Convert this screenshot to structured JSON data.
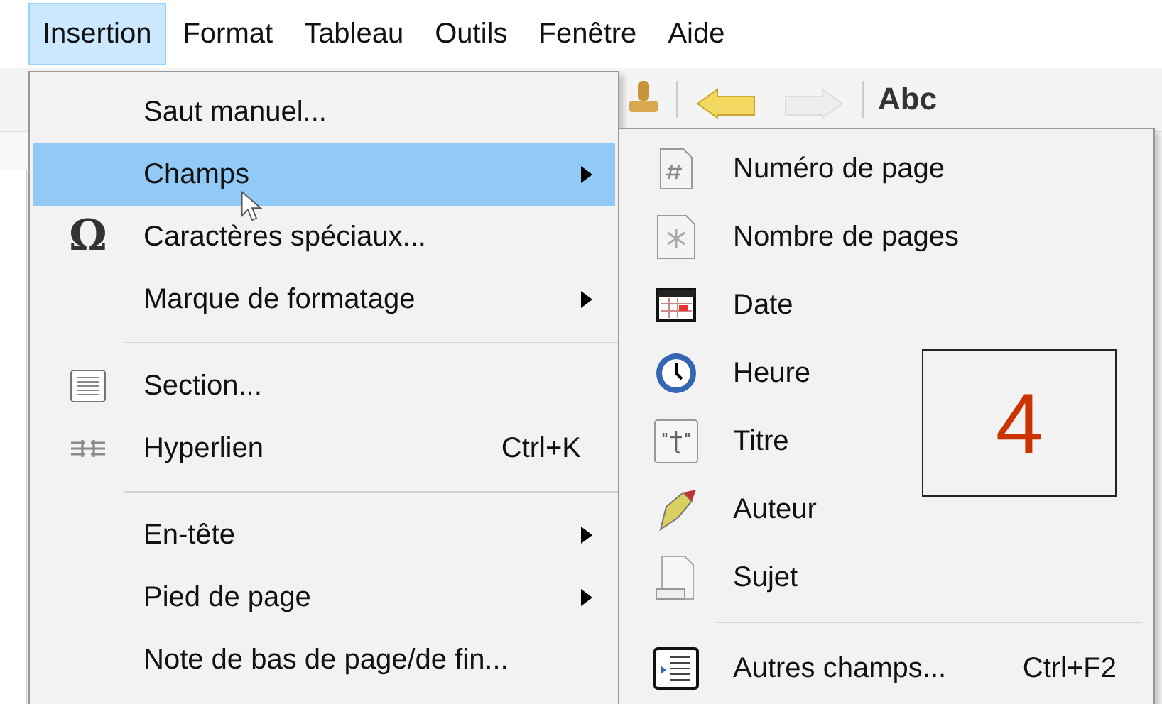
{
  "menu_bar": [
    {
      "label": "Insertion",
      "selected": true
    },
    {
      "label": "Format",
      "selected": false
    },
    {
      "label": "Tableau",
      "selected": false
    },
    {
      "label": "Outils",
      "selected": false
    },
    {
      "label": "Fenêtre",
      "selected": false
    },
    {
      "label": "Aide",
      "selected": false
    }
  ],
  "toolbar": {
    "spelling_label": "Abc"
  },
  "menu": {
    "items": [
      {
        "kind": "item",
        "label": "Saut manuel...",
        "has_submenu": false,
        "selected": false
      },
      {
        "kind": "item",
        "label": "Champs",
        "has_submenu": true,
        "selected": true
      },
      {
        "kind": "item",
        "icon_glyph": "Ω",
        "label": "Caractères spéciaux...",
        "has_submenu": false,
        "selected": false
      },
      {
        "kind": "item",
        "label": "Marque de formatage",
        "has_submenu": true,
        "selected": false
      },
      {
        "kind": "separator"
      },
      {
        "kind": "item",
        "label": "Section...",
        "has_submenu": false,
        "selected": false
      },
      {
        "kind": "item",
        "label": "Hyperlien",
        "shortcut": "Ctrl+K",
        "has_submenu": false,
        "selected": false
      },
      {
        "kind": "separator"
      },
      {
        "kind": "item",
        "label": "En-tête",
        "has_submenu": true,
        "selected": false
      },
      {
        "kind": "item",
        "label": "Pied de page",
        "has_submenu": true,
        "selected": false
      },
      {
        "kind": "item",
        "label": "Note de bas de page/de fin...",
        "has_submenu": false,
        "selected": false
      }
    ]
  },
  "submenu": {
    "items": [
      {
        "kind": "item",
        "label": "Numéro de page"
      },
      {
        "kind": "item",
        "label": "Nombre de pages"
      },
      {
        "kind": "item",
        "label": "Date"
      },
      {
        "kind": "item",
        "label": "Heure"
      },
      {
        "kind": "item",
        "label": "Titre"
      },
      {
        "kind": "item",
        "label": "Auteur"
      },
      {
        "kind": "item",
        "label": "Sujet"
      },
      {
        "kind": "separator"
      },
      {
        "kind": "item",
        "label": "Autres champs...",
        "shortcut": "Ctrl+F2"
      }
    ]
  },
  "annotation": {
    "label": "4"
  }
}
